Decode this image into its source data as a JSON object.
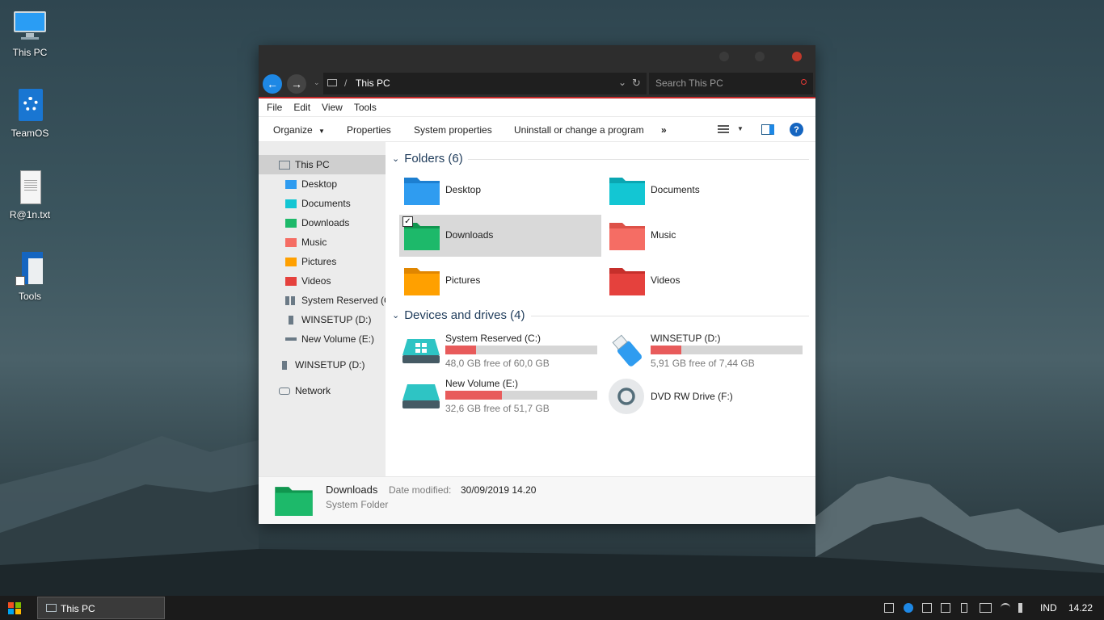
{
  "desktop": {
    "icons": [
      {
        "label": "This PC",
        "icon": "monitor-icon"
      },
      {
        "label": "TeamOS",
        "icon": "settings-file-icon"
      },
      {
        "label": "R@1n.txt",
        "icon": "text-file-icon"
      },
      {
        "label": "Tools",
        "icon": "shortcut-tools-icon"
      }
    ]
  },
  "window": {
    "address": {
      "path": "This PC",
      "separator": "/",
      "search_placeholder": "Search This PC"
    },
    "menu": [
      "File",
      "Edit",
      "View",
      "Tools"
    ],
    "toolbar": {
      "organize": "Organize",
      "properties": "Properties",
      "system_properties": "System properties",
      "uninstall": "Uninstall or change a program",
      "more": "»",
      "help": "?"
    },
    "nav_pane": [
      {
        "label": "This PC",
        "color": "#6b7a86"
      },
      {
        "label": "Desktop",
        "color": "#2f9cf0"
      },
      {
        "label": "Documents",
        "color": "#13c6d3"
      },
      {
        "label": "Downloads",
        "color": "#1db96a"
      },
      {
        "label": "Music",
        "color": "#f56d64"
      },
      {
        "label": "Pictures",
        "color": "#ffa000"
      },
      {
        "label": "Videos",
        "color": "#e5413d"
      },
      {
        "label": "System Reserved (C:)",
        "color": "#6b7a86"
      },
      {
        "label": "WINSETUP (D:)",
        "color": "#6b7a86"
      },
      {
        "label": "New Volume (E:)",
        "color": "#6b7a86"
      },
      {
        "label": "WINSETUP (D:)",
        "color": "#6b7a86"
      },
      {
        "label": "Network",
        "color": "#6b7a86"
      }
    ],
    "folders_group": {
      "title": "Folders (6)"
    },
    "folders": [
      {
        "label": "Desktop",
        "color": "#2f9cf0",
        "dark": "#1d7fd0"
      },
      {
        "label": "Documents",
        "color": "#13c6d3",
        "dark": "#0aa6b2"
      },
      {
        "label": "Downloads",
        "color": "#1db96a",
        "dark": "#10964f"
      },
      {
        "label": "Music",
        "color": "#f56d64",
        "dark": "#dd5148"
      },
      {
        "label": "Pictures",
        "color": "#ffa000",
        "dark": "#e08600"
      },
      {
        "label": "Videos",
        "color": "#e5413d",
        "dark": "#c62f2b"
      }
    ],
    "drives_group": {
      "title": "Devices and drives (4)"
    },
    "drives": [
      {
        "name": "System Reserved (C:)",
        "free": "48,0 GB free of 60,0 GB",
        "used_fraction": 0.2
      },
      {
        "name": "WINSETUP (D:)",
        "free": "5,91 GB free of 7,44 GB",
        "used_fraction": 0.2
      },
      {
        "name": "New Volume (E:)",
        "free": "32,6 GB free of 51,7 GB",
        "used_fraction": 0.37
      },
      {
        "name": "DVD RW Drive (F:)"
      }
    ],
    "details": {
      "name": "Downloads",
      "type": "System Folder",
      "modified_label": "Date modified:",
      "modified_value": "30/09/2019 14.20"
    }
  },
  "taskbar": {
    "task_label": "This PC",
    "language": "IND",
    "clock": "14.22"
  },
  "colors": {
    "accent_red": "#c62828",
    "close_button": "#c0392b",
    "used_bar": "#e85b5b"
  }
}
